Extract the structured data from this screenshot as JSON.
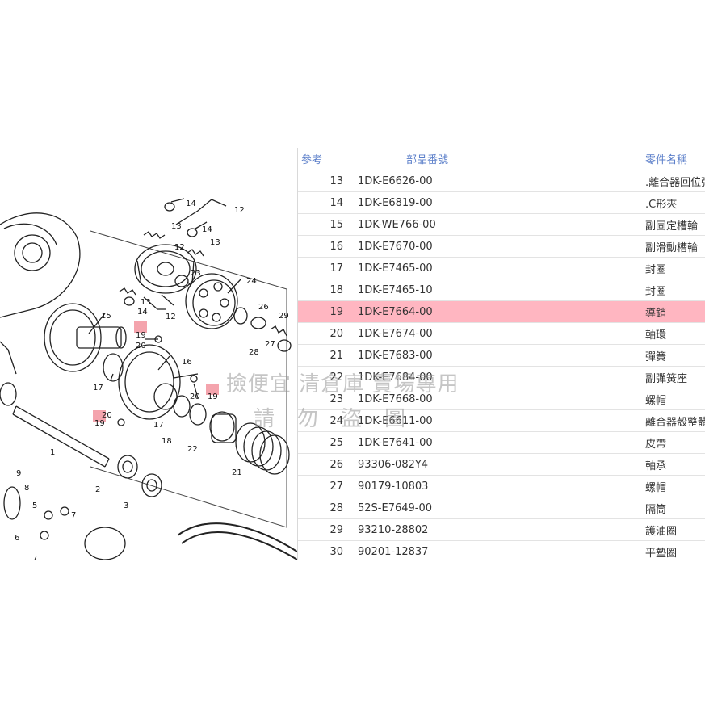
{
  "table": {
    "headers": {
      "ref": "參考",
      "part_number": "部品番號",
      "part_name": "零件名稱"
    },
    "highlight_ref": "19",
    "highlight_color": "#ffb6c1",
    "rows": [
      {
        "ref": "13",
        "part_number": "1DK-E6626-00",
        "part_name": ".離合器回位彈"
      },
      {
        "ref": "14",
        "part_number": "1DK-E6819-00",
        "part_name": ".C形夾"
      },
      {
        "ref": "15",
        "part_number": "1DK-WE766-00",
        "part_name": "副固定槽輪"
      },
      {
        "ref": "16",
        "part_number": "1DK-E7670-00",
        "part_name": "副滑動槽輪"
      },
      {
        "ref": "17",
        "part_number": "1DK-E7465-00",
        "part_name": "封圈"
      },
      {
        "ref": "18",
        "part_number": "1DK-E7465-10",
        "part_name": "封圈"
      },
      {
        "ref": "19",
        "part_number": "1DK-E7664-00",
        "part_name": "導銷"
      },
      {
        "ref": "20",
        "part_number": "1DK-E7674-00",
        "part_name": "軸環"
      },
      {
        "ref": "21",
        "part_number": "1DK-E7683-00",
        "part_name": "彈簧"
      },
      {
        "ref": "22",
        "part_number": "1DK-E7684-00",
        "part_name": "副彈簧座"
      },
      {
        "ref": "23",
        "part_number": "1DK-E7668-00",
        "part_name": "螺帽"
      },
      {
        "ref": "24",
        "part_number": "1DK-E6611-00",
        "part_name": "離合器殼整體"
      },
      {
        "ref": "25",
        "part_number": "1DK-E7641-00",
        "part_name": "皮帶"
      },
      {
        "ref": "26",
        "part_number": "93306-082Y4",
        "part_name": "軸承"
      },
      {
        "ref": "27",
        "part_number": "90179-10803",
        "part_name": "螺帽"
      },
      {
        "ref": "28",
        "part_number": "52S-E7649-00",
        "part_name": "隔筒"
      },
      {
        "ref": "29",
        "part_number": "93210-28802",
        "part_name": "護油圈"
      },
      {
        "ref": "30",
        "part_number": "90201-12837",
        "part_name": "平墊圈"
      }
    ]
  },
  "diagram": {
    "labels": [
      "14",
      "12",
      "13",
      "14",
      "13",
      "12",
      "23",
      "24",
      "13",
      "14",
      "12",
      "26",
      "29",
      "15",
      "19",
      "20",
      "16",
      "28",
      "27",
      "17",
      "20",
      "19",
      "19",
      "20",
      "17",
      "18",
      "22",
      "21",
      "1",
      "2",
      "3",
      "9",
      "8",
      "5",
      "6",
      "7",
      "7"
    ],
    "highlighted_labels": [
      "19"
    ]
  },
  "watermark": {
    "line1": "撿便宜 清倉庫 賣場專用",
    "line2": "請勿盜圖"
  }
}
